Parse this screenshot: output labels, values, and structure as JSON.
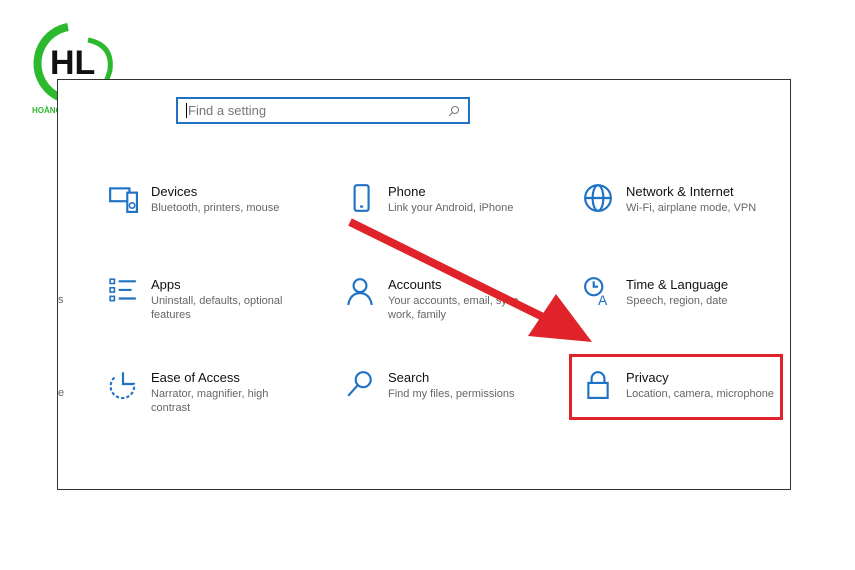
{
  "logo": {
    "text": "HOÀNG LONG COMPUTER",
    "brand_color": "#2db92d"
  },
  "search": {
    "placeholder": "Find a setting",
    "icon": "search-icon"
  },
  "accent": "#1f72c4",
  "highlight_color": "#e0232a",
  "tiles": [
    {
      "title": "Devices",
      "desc": "Bluetooth, printers, mouse",
      "icon": "keyboard-speaker-icon"
    },
    {
      "title": "Phone",
      "desc": "Link your Android, iPhone",
      "icon": "phone-icon"
    },
    {
      "title": "Network & Internet",
      "desc": "Wi-Fi, airplane mode, VPN",
      "icon": "globe-icon"
    },
    {
      "title": "Apps",
      "desc": "Uninstall, defaults, optional features",
      "icon": "list-icon"
    },
    {
      "title": "Accounts",
      "desc": "Your accounts, email, sync, work, family",
      "icon": "person-icon"
    },
    {
      "title": "Time & Language",
      "desc": "Speech, region, date",
      "icon": "time-language-icon"
    },
    {
      "title": "Ease of Access",
      "desc": "Narrator, magnifier, high contrast",
      "icon": "ease-of-access-icon"
    },
    {
      "title": "Search",
      "desc": "Find my files, permissions",
      "icon": "magnifier-icon"
    },
    {
      "title": "Privacy",
      "desc": "Location, camera, microphone",
      "icon": "lock-icon"
    }
  ],
  "edge_fragments": [
    "s",
    "e"
  ]
}
